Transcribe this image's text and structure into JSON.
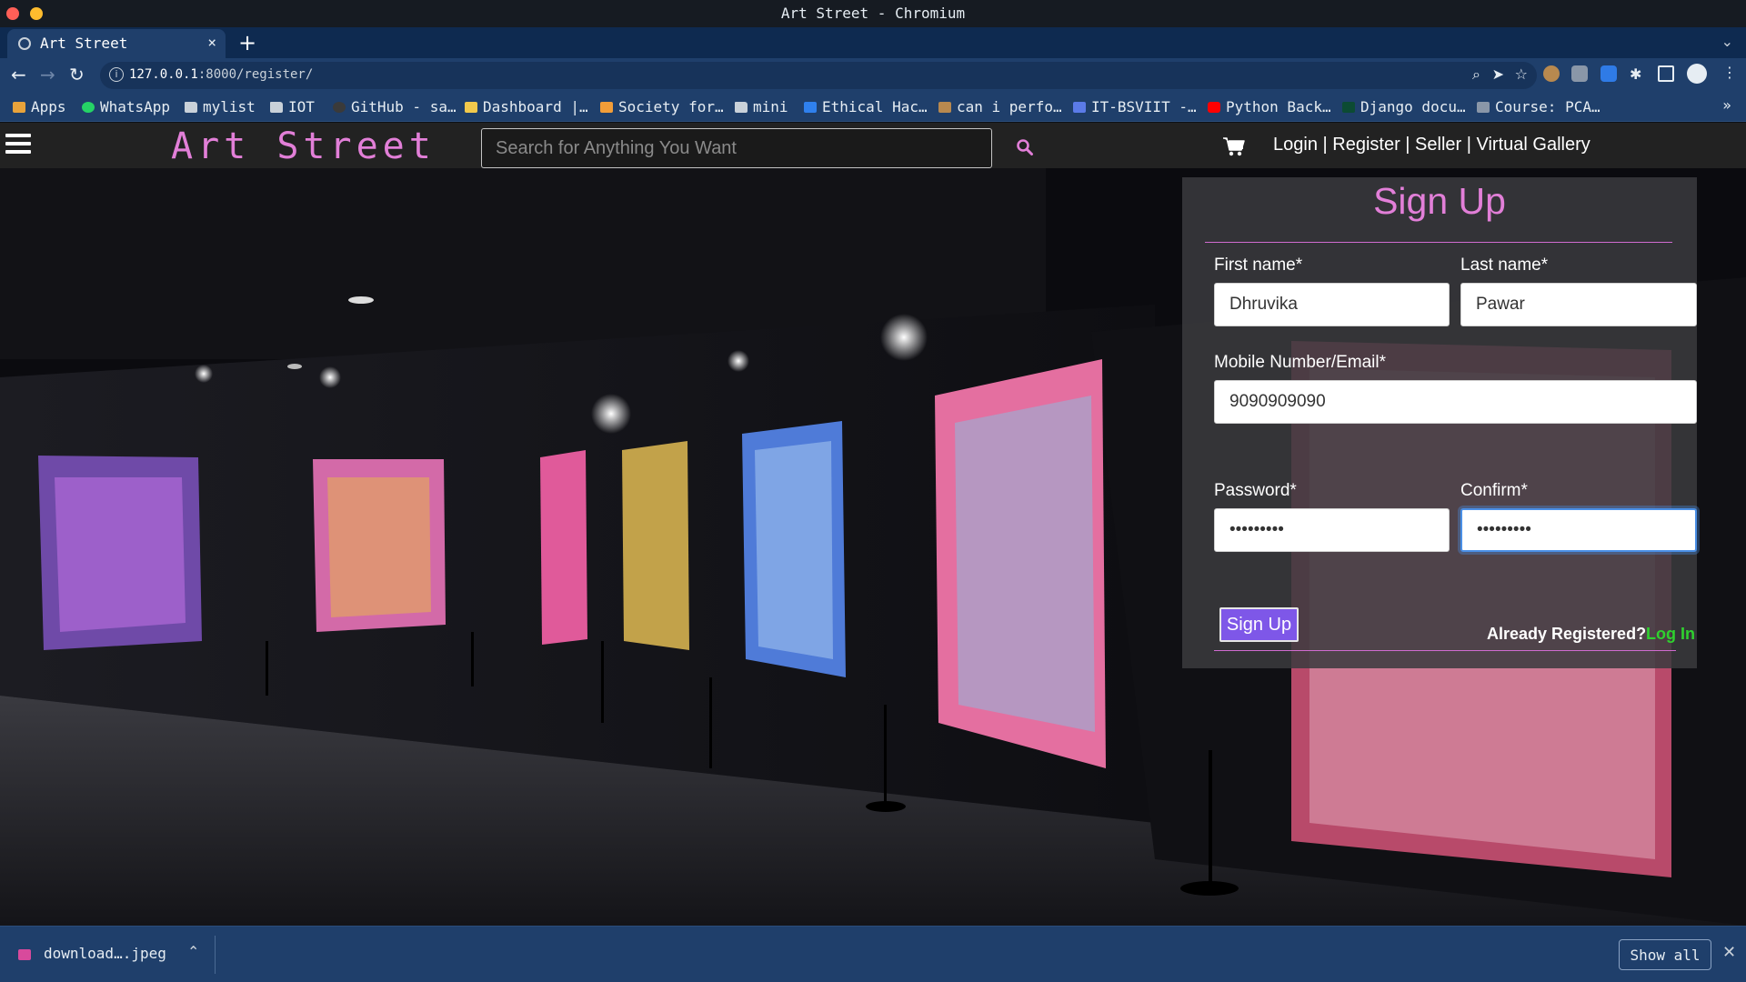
{
  "window": {
    "title": "Art Street - Chromium"
  },
  "tab": {
    "label": "Art Street",
    "close": "×",
    "new_tab": "+"
  },
  "toolbar": {
    "url_host": "127.0.0.1",
    "url_path": ":8000/register/"
  },
  "bookmarks": [
    "Apps",
    "WhatsApp",
    "mylist",
    "IOT",
    "GitHub - sa…",
    "Dashboard |…",
    "Society for…",
    "mini",
    "Ethical Hac…",
    "can i perfo…",
    "IT-BSVIIT -…",
    "Python Back…",
    "Django docu…",
    "Course: PCA…"
  ],
  "site": {
    "brand": "Art Street",
    "search_placeholder": "Search for Anything You Want",
    "nav": {
      "login": "Login",
      "register": "Register",
      "seller": "Seller",
      "virtual_gallery": "Virtual Gallery",
      "separator": " | "
    }
  },
  "form": {
    "title": "Sign Up",
    "first_name_label": "First name*",
    "first_name_value": "Dhruvika",
    "last_name_label": "Last name*",
    "last_name_value": "Pawar",
    "contact_label": "Mobile Number/Email*",
    "contact_value": "9090909090",
    "password_label": "Password*",
    "password_value": "•••••••••",
    "confirm_label": "Confirm*",
    "confirm_value": "•••••••••",
    "submit_label": "Sign Up",
    "already_text": "Already Registered?",
    "login_link": "Log In"
  },
  "downloads": {
    "file": "download….jpeg",
    "show_all": "Show all"
  },
  "colors": {
    "brand_pink": "#e27fd8",
    "button_purple": "#7e57e8",
    "link_green": "#2fd12f",
    "chrome_blue": "#1f3f6b"
  }
}
